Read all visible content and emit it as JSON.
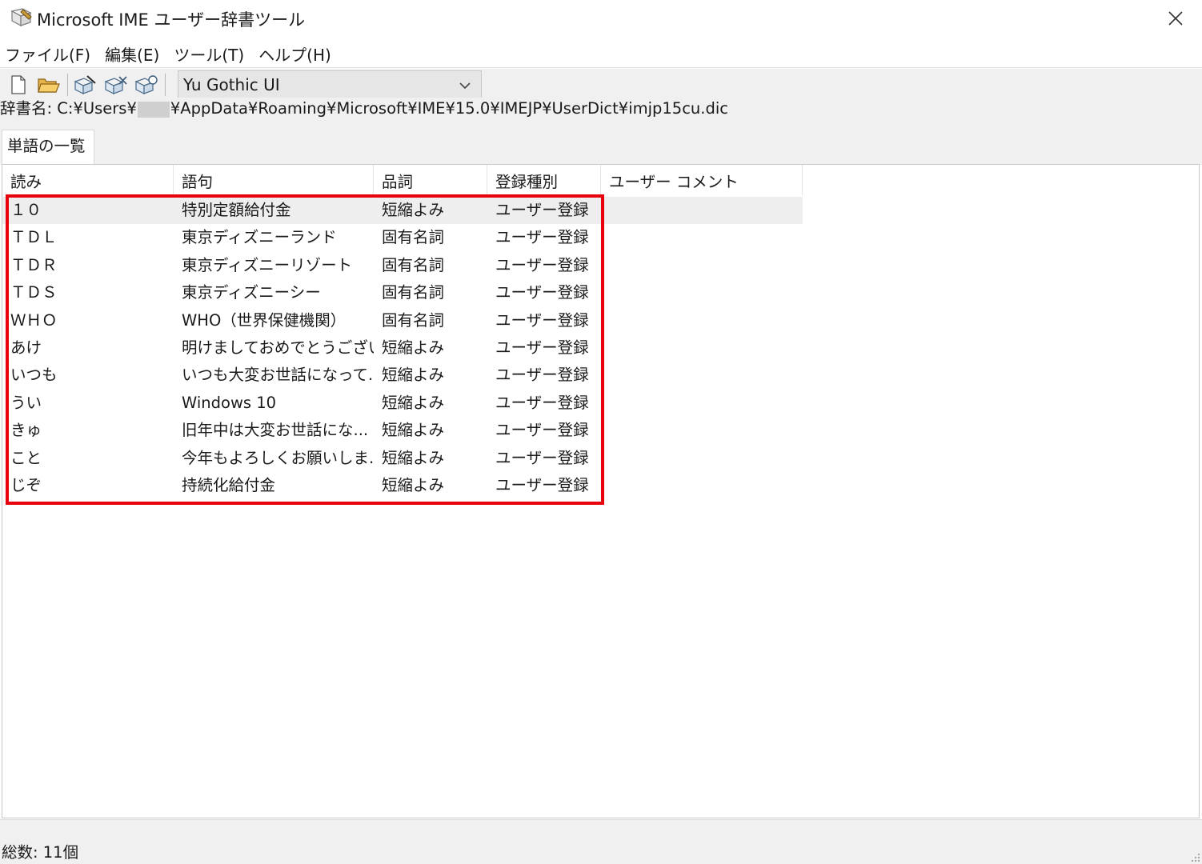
{
  "window": {
    "title": "Microsoft IME ユーザー辞書ツール"
  },
  "menu": [
    {
      "label": "ファイル(F)"
    },
    {
      "label": "編集(E)"
    },
    {
      "label": "ツール(T)"
    },
    {
      "label": "ヘルプ(H)"
    }
  ],
  "toolbar": {
    "icons": [
      "new-file-icon",
      "open-folder-icon",
      "edit-word-icon",
      "delete-word-icon",
      "register-word-icon"
    ],
    "font_select_value": "Yu Gothic UI"
  },
  "dictionary": {
    "prefix": "辞書名: C:¥Users¥",
    "suffix": "¥AppData¥Roaming¥Microsoft¥IME¥15.0¥IMEJP¥UserDict¥imjp15cu.dic"
  },
  "tabs": [
    {
      "label": "単語の一覧"
    }
  ],
  "list": {
    "columns": [
      "読み",
      "語句",
      "品詞",
      "登録種別",
      "ユーザー コメント"
    ],
    "rows": [
      {
        "yomi": "１０",
        "goku": "特別定額給付金",
        "hinshi": "短縮よみ",
        "shubetsu": "ユーザー登録",
        "comment": ""
      },
      {
        "yomi": "ＴＤＬ",
        "goku": "東京ディズニーランド",
        "hinshi": "固有名詞",
        "shubetsu": "ユーザー登録",
        "comment": ""
      },
      {
        "yomi": "ＴＤＲ",
        "goku": "東京ディズニーリゾート",
        "hinshi": "固有名詞",
        "shubetsu": "ユーザー登録",
        "comment": ""
      },
      {
        "yomi": "ＴＤＳ",
        "goku": "東京ディズニーシー",
        "hinshi": "固有名詞",
        "shubetsu": "ユーザー登録",
        "comment": ""
      },
      {
        "yomi": "ＷＨＯ",
        "goku": "WHO（世界保健機関）",
        "hinshi": "固有名詞",
        "shubetsu": "ユーザー登録",
        "comment": ""
      },
      {
        "yomi": "あけ",
        "goku": "明けましておめでとうござい...",
        "hinshi": "短縮よみ",
        "shubetsu": "ユーザー登録",
        "comment": ""
      },
      {
        "yomi": "いつも",
        "goku": "いつも大変お世話になって...",
        "hinshi": "短縮よみ",
        "shubetsu": "ユーザー登録",
        "comment": ""
      },
      {
        "yomi": "うい",
        "goku": "Windows 10",
        "hinshi": "短縮よみ",
        "shubetsu": "ユーザー登録",
        "comment": ""
      },
      {
        "yomi": "きゅ",
        "goku": "旧年中は大変お世話にな...",
        "hinshi": "短縮よみ",
        "shubetsu": "ユーザー登録",
        "comment": ""
      },
      {
        "yomi": "こと",
        "goku": "今年もよろしくお願いしま...",
        "hinshi": "短縮よみ",
        "shubetsu": "ユーザー登録",
        "comment": ""
      },
      {
        "yomi": "じぞ",
        "goku": "持続化給付金",
        "hinshi": "短縮よみ",
        "shubetsu": "ユーザー登録",
        "comment": ""
      }
    ],
    "selected_index": 0,
    "highlight_color": "#e8000b"
  },
  "status": {
    "total": "総数: 11個"
  }
}
